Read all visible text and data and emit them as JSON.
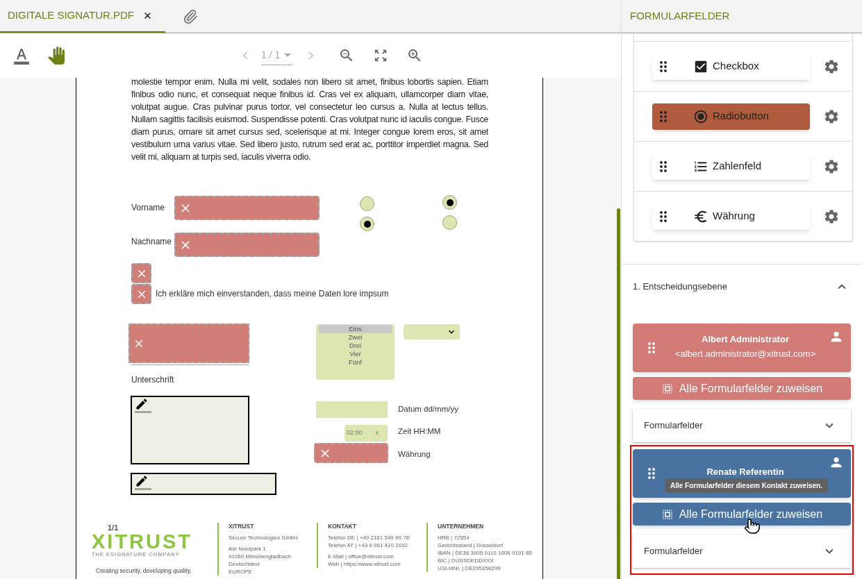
{
  "tabs": [
    {
      "label": "DIGITALE SIGNATUR.PDF",
      "selected": true
    }
  ],
  "toolbar": {
    "tools": [
      {
        "kind": "text",
        "selected": false
      },
      {
        "kind": "hand",
        "selected": true
      }
    ],
    "pager": "1 / 1"
  },
  "document": {
    "paragraph": "molestie tempor enim. Nulla mi velit, sodales non libero sit amet, finibus lobortis sapien. Etiam finibus odio nunc, et consequat neque finibus id. Cras vel ex aliquam, ullamcorper diam vitae, volutpat augue. Cras pulvinar purus tortor, vel consectetur leo cursus a. Nulla at lectus tellus. Nullam sagittis facilisis euismod. Suspendisse potenti. Cras volutpat nunc id iaculis congue. Fusce diam purus, ornare sit amet cursus sed, scelerisque at mi. Integer congue lorem eros, sit amet vestibulum urna varius vitae. Sed libero justo, rutrum sed erat ac, porttitor imperdiet magna. Sed velit mi, aliquam at turpis sed, iaculis viverra odio.",
    "name_fields": [
      {
        "label": "Vorname",
        "invalid": true
      },
      {
        "label": "Nachname",
        "invalid": true
      }
    ],
    "radios": [
      {
        "selected": false
      },
      {
        "selected": true
      },
      {
        "selected": true
      },
      {
        "selected": false
      }
    ],
    "checkboxes": [
      {
        "invalid": true
      },
      {
        "invalid": true,
        "label": "Ich erkläre mich einverstanden, dass meine Daten lore impsum"
      }
    ],
    "signature_fields": [
      {
        "invalid": true,
        "label": "Unterschrift"
      },
      {
        "invalid": false
      },
      {
        "invalid": false
      }
    ],
    "listbox": [
      {
        "label": "Eins",
        "selected": true
      },
      {
        "label": "Zwei",
        "selected": false
      },
      {
        "label": "Drei",
        "selected": false
      },
      {
        "label": "Vier",
        "selected": false
      },
      {
        "label": "Fünf",
        "selected": false
      }
    ],
    "date_field": {
      "label": "Datum dd/mm/yy"
    },
    "time_field": {
      "value": "02:00",
      "clear": "x",
      "label": "Zeit HH:MM"
    },
    "currency_field": {
      "label": "Währung",
      "invalid": true
    },
    "page_number": "1/1",
    "footer": {
      "logo": "XITRUST",
      "tagline": "THE ESIGNATURE COMPANY",
      "slogan": "Creating security, developing quality.",
      "columns": [
        {
          "heading": "XITRUST",
          "groups": [
            [
              "Secure Technologies GmbH"
            ],
            [
              "Am Nordpark 1",
              "41069 Mönchengladbach",
              "Deutschland",
              "EUROPE"
            ]
          ]
        },
        {
          "heading": "KONTAKT",
          "groups": [
            [
              "Telefon DE | +49 2161 549 99 78",
              "Telefon AT | +43 6 991 410 2032"
            ],
            [
              "E-Mail | office@xitrust.com",
              "Web | https://www.xitrust.com"
            ]
          ]
        },
        {
          "heading": "UNTERNEHMEN",
          "groups": [
            [
              "HRB | 72554",
              "Gerichtsstand | Düsseldorf",
              "IBAN | DE38 3005 0110 1006 9191 85",
              "BIC | DUSSDEDDXXX",
              "USt-IdNr. | DE295158299"
            ]
          ]
        }
      ]
    }
  },
  "sidebar": {
    "title": "FORMULARFELDER",
    "field_types": [
      {
        "kind": "checkbox",
        "label": "Checkbox",
        "selected": false
      },
      {
        "kind": "radio",
        "label": "Radiobutton",
        "selected": true
      },
      {
        "kind": "number",
        "label": "Zahlenfeld",
        "selected": false
      },
      {
        "kind": "currency",
        "label": "Währung",
        "selected": false
      }
    ],
    "section": {
      "title": "1. Entscheidungsebene",
      "expanded": true
    },
    "contacts": [
      {
        "name": "Albert Administrator",
        "email": "<albert.administrator@xitrust.com>",
        "color": "#d27a76",
        "assign_label": "Alle Formularfelder zuweisen",
        "fields_label": "Formularfelder",
        "fields_expanded": false,
        "hovered": false,
        "highlighted": false
      },
      {
        "name": "Renate Referentin",
        "color": "#4a73a1",
        "tooltip": "Alle Formularfelder diesem Kontakt zuweisen.",
        "assign_label": "Alle Formularfelder zuweisen",
        "fields_label": "Formularfelder",
        "fields_expanded": false,
        "hovered": true,
        "highlighted": true
      }
    ]
  }
}
